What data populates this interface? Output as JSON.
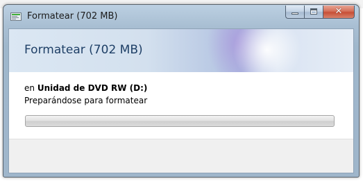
{
  "window": {
    "title": "Formatear (702 MB)",
    "controls": {
      "minimize": "minimize-icon",
      "maximize": "maximize-icon",
      "close": "close-icon"
    }
  },
  "header": {
    "title": "Formatear (702 MB)"
  },
  "operation": {
    "destination_prefix": "en",
    "destination_name": "Unidad de DVD RW (D:)",
    "status": "Preparándose para formatear",
    "progress": 0
  },
  "colors": {
    "header_text": "#1e3f66",
    "progress_track": "#dcdcdc",
    "close_button": "#c74f36"
  }
}
